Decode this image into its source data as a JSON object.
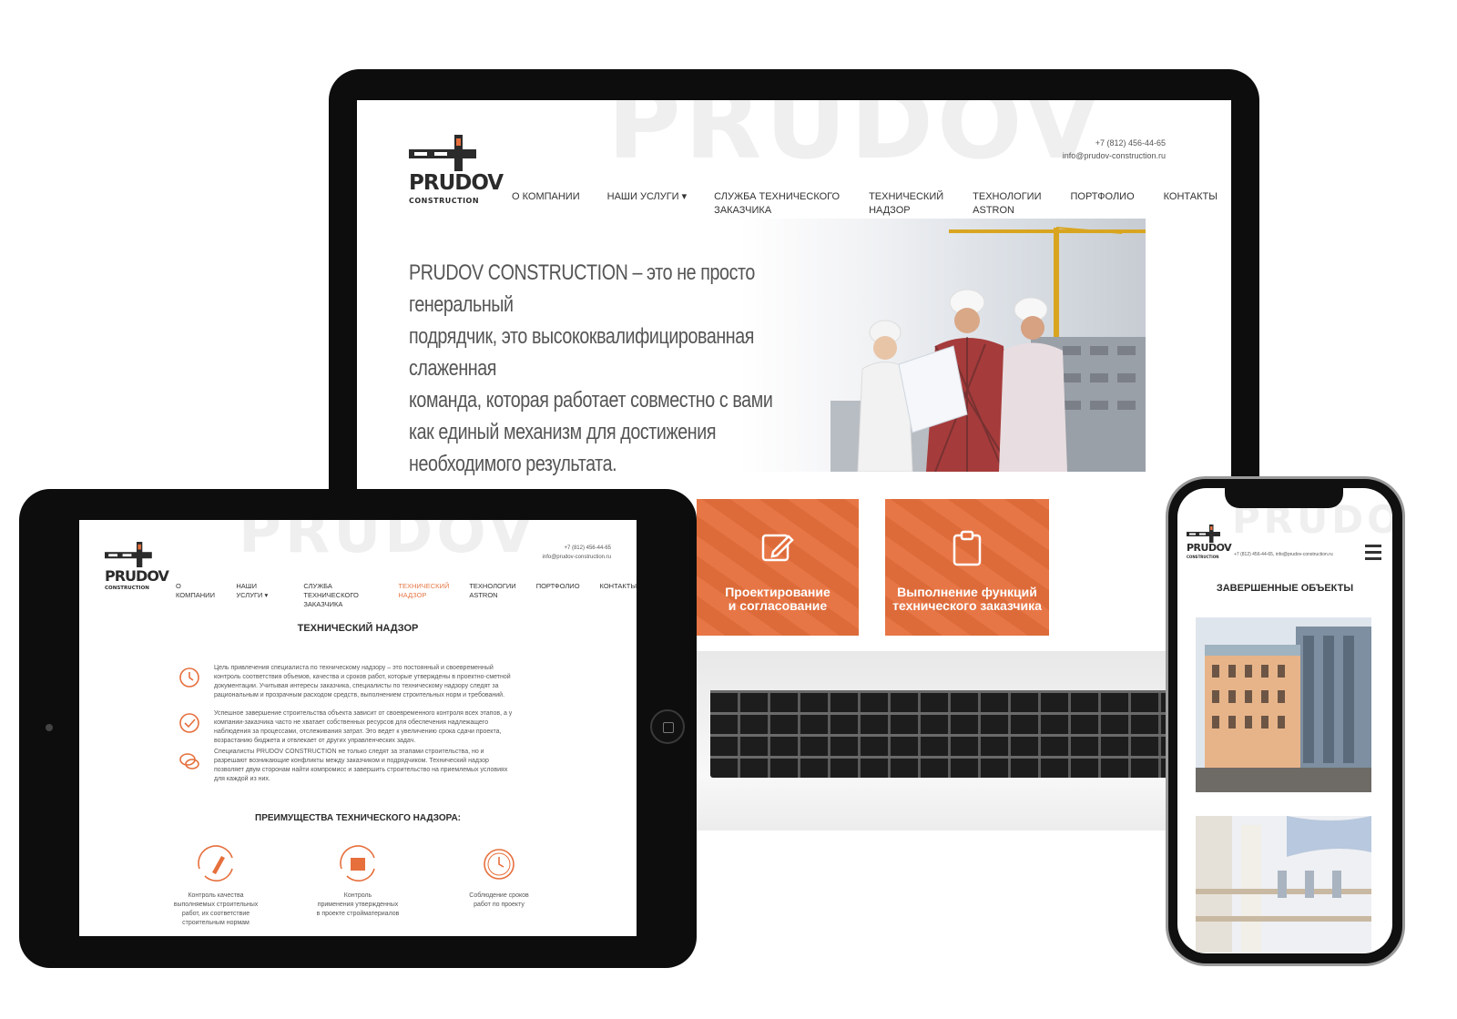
{
  "brand": {
    "name": "PRUDOV",
    "sub": "CONSTRUCTION",
    "watermark": "PRUDOV",
    "accent": "#e66f3c",
    "dark": "#2b2b2b"
  },
  "contacts": {
    "phone": "+7 (812) 456-44-65",
    "email": "info@prudov-construction.ru",
    "phone_mobile_line": "+7 (812) 456-44-65, info@prudov-construction.ru"
  },
  "nav": {
    "about": "О КОМПАНИИ",
    "services": "НАШИ УСЛУГИ ▾",
    "customer": "СЛУЖБА ТЕХНИЧЕСКОГО\nЗАКАЗЧИКА",
    "supervision": "ТЕХНИЧЕСКИЙ\nНАДЗОР",
    "tech": "ТЕХНОЛОГИИ\nASTRON",
    "portfolio": "ПОРТФОЛИО",
    "contacts": "КОНТАКТЫ"
  },
  "laptop": {
    "hero_text": "PRUDOV CONSTRUCTION – это не просто генеральный\nподрядчик, это высококвалифицированная слаженная\nкоманда, которая работает совместно с вами\nкак единый механизм для достижения\nнеобходимого результата.",
    "tiles": [
      {
        "label": "Проектирование\nи согласование",
        "icon": "pencil-square-icon"
      },
      {
        "label": "Выполнение функций\nтехнического заказчика",
        "icon": "clipboard-icon"
      }
    ]
  },
  "tablet": {
    "title": "ТЕХНИЧЕСКИЙ НАДЗОР",
    "paragraphs": [
      {
        "icon": "clock-icon",
        "text": "Цель привлечения специалиста по техническому надзору – это постоянный и своевременный контроль соответствия объемов, качества и сроков работ, которые утверждены в проектно-сметной документации. Учитывая интересы заказчика, специалисты по техническому надзору следят за рациональным и прозрачным расходом средств, выполнением строительных норм и требований."
      },
      {
        "icon": "check-circle-icon",
        "text": "Успешное завершение строительства объекта зависит от своевременного контроля всех этапов, а у компании-заказчика часто не хватает собственных ресурсов для обеспечения надлежащего наблюдения за процессами, отслеживания затрат. Это ведет к увеличению срока сдачи проекта, возрастанию бюджета и отвлекает от других управленческих задач."
      },
      {
        "icon": "chat-bubbles-icon",
        "text": "Специалисты PRUDOV CONSTRUCTION не только следят за этапами строительства, но и разрешают возникающие конфликты между заказчиком и подрядчиком. Технический надзор позволяет двум сторонам найти компромисс и завершить строительство на приемлемых условиях для каждой из них."
      }
    ],
    "adv_title": "ПРЕИМУЩЕСТВА ТЕХНИЧЕСКОГО НАДЗОРА:",
    "advantages": [
      {
        "icon": "quality-control-icon",
        "text": "Контроль качества\nвыполняемых строительных\nработ, их соответствие\nстроительным нормам"
      },
      {
        "icon": "materials-control-icon",
        "text": "Контроль\nприменения утвержденных\nв проекте стройматериалов"
      },
      {
        "icon": "timer-icon",
        "text": "Соблюдение сроков\nработ по проекту"
      }
    ]
  },
  "phone": {
    "section_title": "ЗАВЕРШЕННЫЕ ОБЪЕКТЫ",
    "menu_icon": "hamburger-icon"
  }
}
